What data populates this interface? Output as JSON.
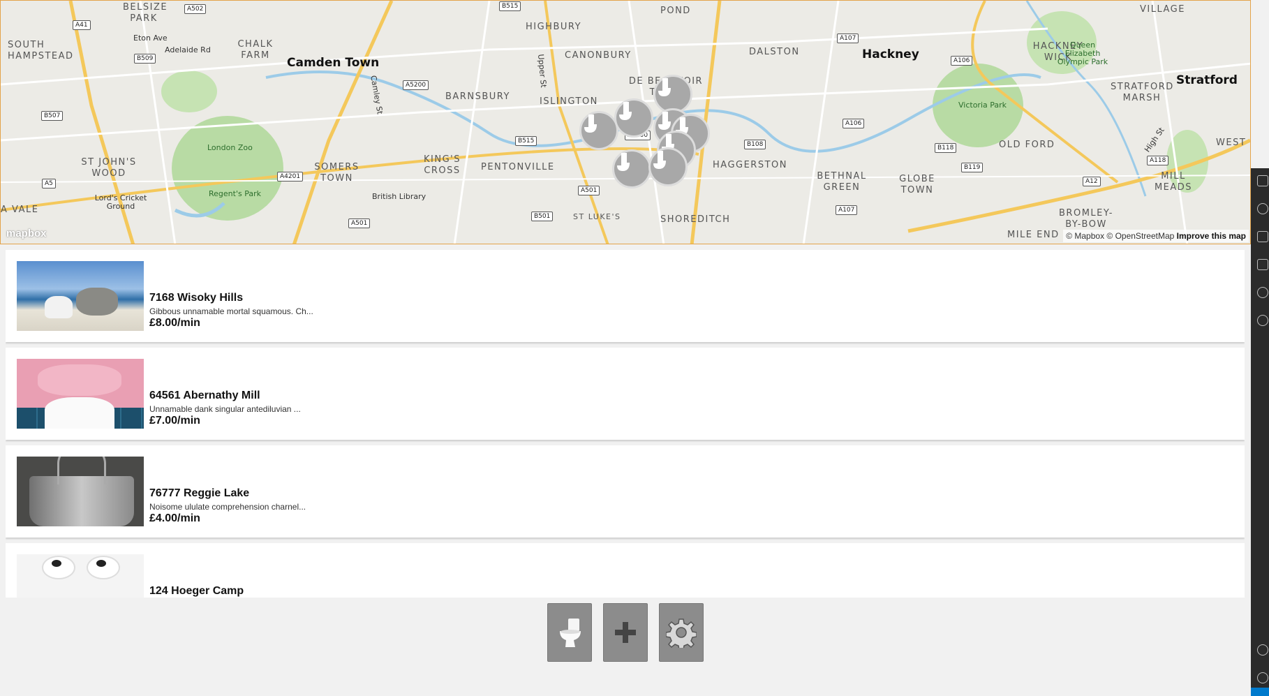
{
  "map": {
    "places": [
      {
        "name": "BELSIZE PARK",
        "cls": "mid"
      },
      {
        "name": "SOUTH HAMPSTEAD",
        "cls": "mid"
      },
      {
        "name": "CHALK FARM",
        "cls": "mid"
      },
      {
        "name": "Camden Town",
        "cls": "big"
      },
      {
        "name": "HIGHBURY",
        "cls": "mid"
      },
      {
        "name": "CANONBURY",
        "cls": "mid"
      },
      {
        "name": "DE BEAUVOIR TOWN",
        "cls": "mid"
      },
      {
        "name": "DALSTON",
        "cls": "mid"
      },
      {
        "name": "Hackney",
        "cls": "big"
      },
      {
        "name": "HACKNEY WICK",
        "cls": "mid"
      },
      {
        "name": "Queen Elizabeth Olympic Park",
        "cls": "small"
      },
      {
        "name": "Stratford",
        "cls": "big"
      },
      {
        "name": "STRATFORD MARSH",
        "cls": "mid"
      },
      {
        "name": "Victoria Park",
        "cls": "small"
      },
      {
        "name": "BARNSBURY",
        "cls": "mid"
      },
      {
        "name": "ISLINGTON",
        "cls": "mid"
      },
      {
        "name": "London Zoo",
        "cls": "small"
      },
      {
        "name": "ST JOHN'S WOOD",
        "cls": "mid"
      },
      {
        "name": "SOMERS TOWN",
        "cls": "mid"
      },
      {
        "name": "KING'S CROSS",
        "cls": "mid"
      },
      {
        "name": "PENTONVILLE",
        "cls": "mid"
      },
      {
        "name": "HAGGERSTON",
        "cls": "mid"
      },
      {
        "name": "BETHNAL GREEN",
        "cls": "mid"
      },
      {
        "name": "GLOBE TOWN",
        "cls": "mid"
      },
      {
        "name": "OLD FORD",
        "cls": "mid"
      },
      {
        "name": "WEST H",
        "cls": "mid"
      },
      {
        "name": "MILL MEADS",
        "cls": "mid"
      },
      {
        "name": "Regent's Park",
        "cls": "small"
      },
      {
        "name": "Lord's Cricket Ground",
        "cls": "small"
      },
      {
        "name": "British Library",
        "cls": "small"
      },
      {
        "name": "ST LUKE'S",
        "cls": "mid"
      },
      {
        "name": "SHOREDITCH",
        "cls": "mid"
      },
      {
        "name": "MILE END",
        "cls": "mid"
      },
      {
        "name": "BROMLEY-BY-BOW",
        "cls": "mid"
      },
      {
        "name": "A VALE",
        "cls": "mid"
      },
      {
        "name": "VILLAGE",
        "cls": "mid"
      },
      {
        "name": "POND",
        "cls": "mid"
      },
      {
        "name": "Eton Ave",
        "cls": "small"
      },
      {
        "name": "Adelaide Rd",
        "cls": "small"
      },
      {
        "name": "Upper St",
        "cls": "small"
      },
      {
        "name": "Camley St",
        "cls": "small"
      },
      {
        "name": "High St",
        "cls": "small"
      }
    ],
    "roads": [
      "A41",
      "A502",
      "B515",
      "B509",
      "A5200",
      "B507",
      "A5",
      "A4201",
      "B515",
      "A1200",
      "A501",
      "B501",
      "A501",
      "A107",
      "A106",
      "A106",
      "B108",
      "B118",
      "B119",
      "A107",
      "A12",
      "A118"
    ],
    "logo": "mapbox",
    "attribution": "© Mapbox © OpenStreetMap",
    "improve": "Improve this map",
    "marker_count": 8
  },
  "listings": [
    {
      "title": "7168 Wisoky Hills",
      "description": "Gibbous unnamable mortal squamous. Ch...",
      "price": "£8.00/min",
      "image": "beach-toilet"
    },
    {
      "title": "64561 Abernathy Mill",
      "description": "Unnamable dank singular antediluvian ...",
      "price": "£7.00/min",
      "image": "pink-toilet"
    },
    {
      "title": "76777 Reggie Lake",
      "description": "Noisome ululate comprehension charnel...",
      "price": "£4.00/min",
      "image": "metal-bucket"
    },
    {
      "title": "124 Hoeger Camp",
      "description": "",
      "price": "",
      "image": "toilet-paper"
    }
  ],
  "toolbar": {
    "buttons": [
      {
        "name": "toilets-button",
        "icon": "toilet-icon"
      },
      {
        "name": "add-button",
        "icon": "plus-icon"
      },
      {
        "name": "settings-button",
        "icon": "gear-icon"
      }
    ]
  },
  "colors": {
    "marker": "#a8a8a8",
    "accent": "#007acc",
    "map_border": "#e3a34a"
  }
}
